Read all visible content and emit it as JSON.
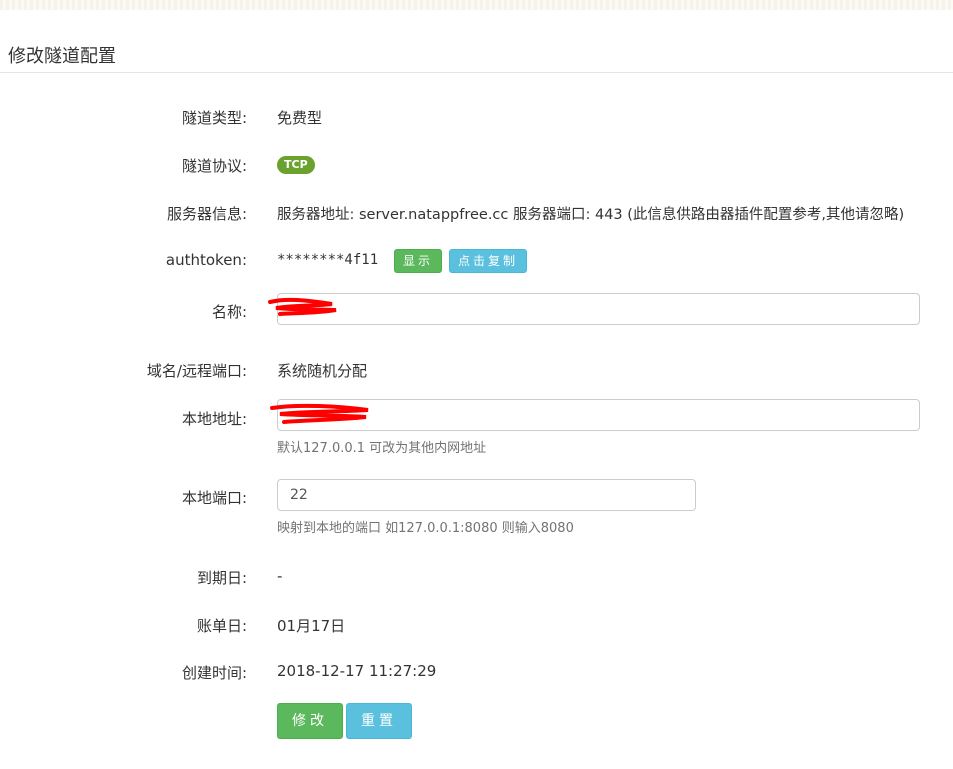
{
  "page": {
    "title": "修改隧道配置"
  },
  "fields": {
    "type": {
      "label": "隧道类型:",
      "value": "免费型"
    },
    "protocol": {
      "label": "隧道协议:",
      "badge": "TCP",
      "badge_color": "#6aa22d"
    },
    "server": {
      "label": "服务器信息:",
      "value": "服务器地址: server.natappfree.cc 服务器端口: 443 (此信息供路由器插件配置参考,其他请忽略)"
    },
    "authtoken": {
      "label": "authtoken:",
      "value": "********4f11",
      "show_label": "显示",
      "copy_label": "点击复制"
    },
    "name": {
      "label": "名称:",
      "value": ""
    },
    "domain": {
      "label": "域名/远程端口:",
      "value": "系统随机分配"
    },
    "local_addr": {
      "label": "本地地址:",
      "value": "",
      "help": "默认127.0.0.1 可改为其他内网地址"
    },
    "local_port": {
      "label": "本地端口:",
      "value": "22",
      "help": "映射到本地的端口 如127.0.0.1:8080 则输入8080"
    },
    "expire": {
      "label": "到期日:",
      "value": "-"
    },
    "bill_day": {
      "label": "账单日:",
      "value": "01月17日"
    },
    "created": {
      "label": "创建时间:",
      "value": "2018-12-17 11:27:29"
    }
  },
  "actions": {
    "submit_label": "修改",
    "reset_label": "重置"
  },
  "colors": {
    "success": "#5cb85c",
    "info": "#5bc0de",
    "redaction": "#ff0000"
  }
}
